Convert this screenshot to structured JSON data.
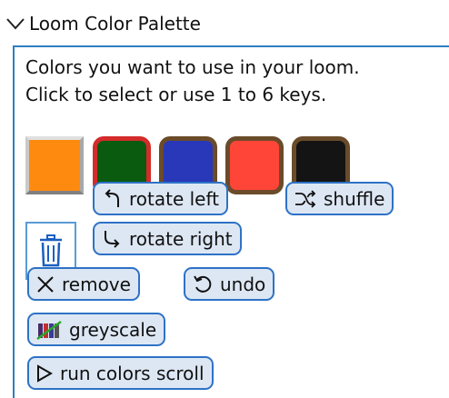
{
  "header": {
    "title": "Loom Color Palette",
    "icon": "chevron-down-icon"
  },
  "description": {
    "line1": "Colors you want to use in your loom.",
    "line2": "Click to select or use 1 to 6 keys."
  },
  "palette": [
    {
      "color": "#ff8a10",
      "state": "selected"
    },
    {
      "color": "#0a5a10",
      "state": "active"
    },
    {
      "color": "#2838b8",
      "state": "normal"
    },
    {
      "color": "#ff4438",
      "state": "normal"
    },
    {
      "color": "#141414",
      "state": "normal"
    }
  ],
  "buttons": {
    "trash_icon": "trash-icon",
    "rotate_left": "rotate left",
    "shuffle": "shuffle",
    "rotate_right": "rotate right",
    "remove": "remove",
    "undo": "undo",
    "greyscale": "greyscale",
    "run_colors_scroll": "run colors scroll"
  },
  "colors": {
    "accent": "#2e72c6",
    "button_bg": "#dde7f4"
  }
}
